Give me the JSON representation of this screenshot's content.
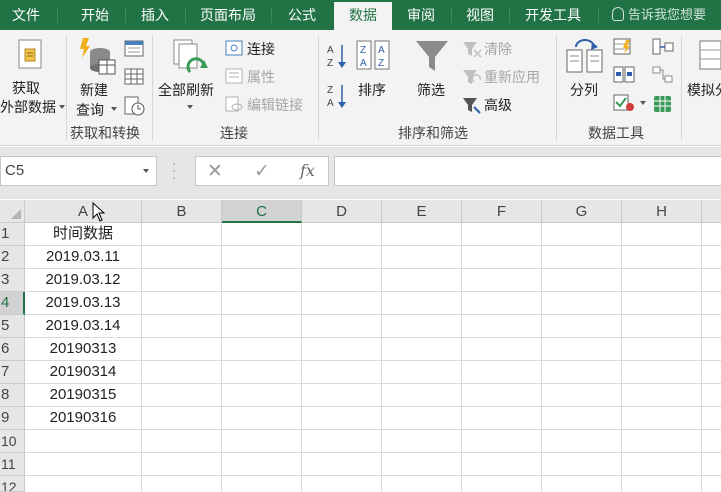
{
  "tabs": [
    {
      "label": "文件",
      "active": false
    },
    {
      "label": "开始",
      "active": false
    },
    {
      "label": "插入",
      "active": false
    },
    {
      "label": "页面布局",
      "active": false
    },
    {
      "label": "公式",
      "active": false
    },
    {
      "label": "数据",
      "active": true
    },
    {
      "label": "审阅",
      "active": false
    },
    {
      "label": "视图",
      "active": false
    },
    {
      "label": "开发工具",
      "active": false
    }
  ],
  "tell_me": "告诉我您想要",
  "ribbon": {
    "get_external_data": {
      "line1": "获取",
      "line2": "外部数据"
    },
    "new_query": {
      "line1": "新建",
      "line2": "查询"
    },
    "group_get_transform": "获取和转换",
    "refresh_all": "全部刷新",
    "connections": "连接",
    "properties": "属性",
    "edit_links": "编辑链接",
    "group_connections": "连接",
    "sort": "排序",
    "filter": "筛选",
    "clear": "清除",
    "reapply": "重新应用",
    "advanced": "高级",
    "group_sort_filter": "排序和筛选",
    "text_to_columns": "分列",
    "group_data_tools": "数据工具",
    "what_if": "模拟分"
  },
  "formula_bar": {
    "name_box": "C5",
    "cancel_glyph": "✕",
    "enter_glyph": "✓",
    "fx_label": "fx",
    "formula": ""
  },
  "columns": [
    "A",
    "B",
    "C",
    "D",
    "E",
    "F",
    "G",
    "H"
  ],
  "rows": [
    "1",
    "2",
    "3",
    "4",
    "5",
    "6",
    "7",
    "8",
    "9",
    "10",
    "11",
    "12"
  ],
  "cells_a": [
    "时间数据",
    "2019.03.11",
    "2019.03.12",
    "2019.03.13",
    "2019.03.14",
    "20190313",
    "20190314",
    "20190315",
    "20190316"
  ],
  "colors": {
    "accent": "#217346",
    "ribbon_bg": "#f3f3f3",
    "gridline": "#dadada"
  }
}
